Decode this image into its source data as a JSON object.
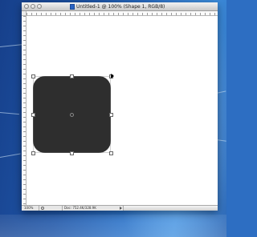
{
  "window": {
    "title": "Untitled-1 @ 100% (Shape 1, RGB/8)"
  },
  "statusbar": {
    "zoom": "100%",
    "doc_size": "Doc: 752.4K/328.9K"
  },
  "colors": {
    "shape_fill": "#2e2e2e",
    "canvas": "#ffffff",
    "desktop": "#2b72c8"
  },
  "icons": {
    "close": "close-icon",
    "minimize": "minimize-icon",
    "zoom": "zoom-icon",
    "document": "photoshop-document-icon"
  }
}
